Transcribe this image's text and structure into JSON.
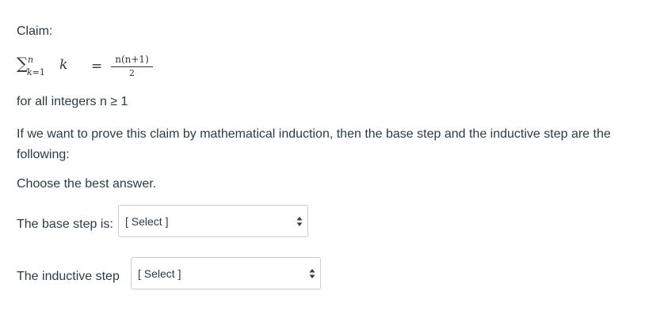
{
  "claim_label": "Claim:",
  "formula": {
    "sigma": "∑",
    "upper": "n",
    "lower_var": "k",
    "lower_rest": "=1",
    "summand": "k",
    "equals": "=",
    "numerator": "n(n+1)",
    "denominator": "2"
  },
  "condition": "for all integers  n ≥ 1",
  "question": "If we want to prove this claim by mathematical induction, then the base step and the inductive step are the following:",
  "instruction": "Choose the best answer.",
  "base_step": {
    "label": "The base step is:",
    "selected": "[ Select ]"
  },
  "inductive_step": {
    "label": "The inductive step",
    "selected": "[ Select ]"
  }
}
